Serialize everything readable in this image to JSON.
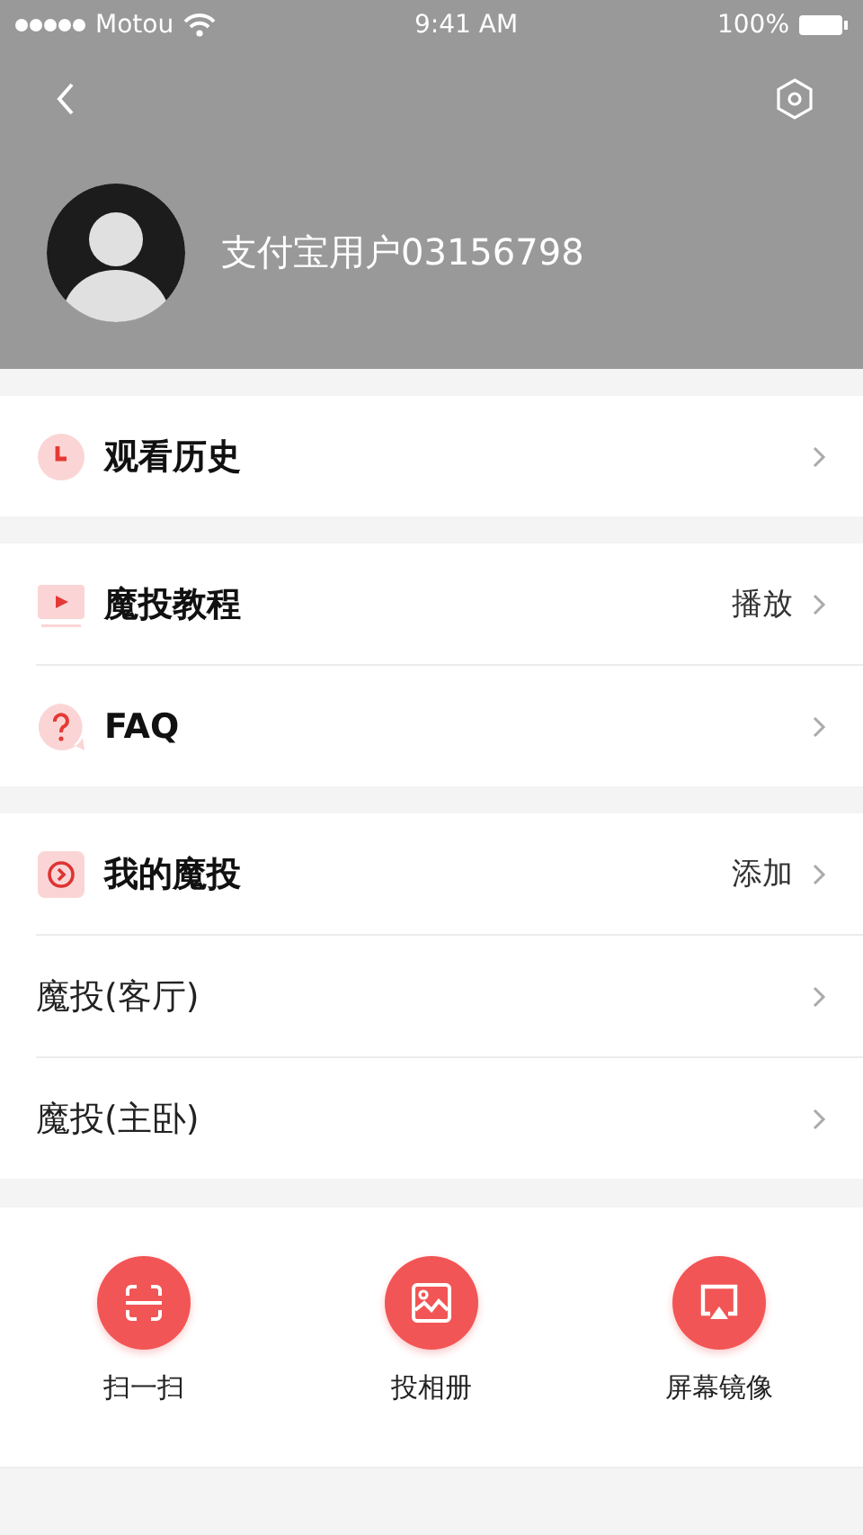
{
  "status_bar": {
    "carrier": "Motou",
    "time": "9:41 AM",
    "battery": "100%"
  },
  "profile": {
    "name": "支付宝用户03156798"
  },
  "sections": [
    {
      "rows": [
        {
          "kind": "icon",
          "label": "观看历史"
        }
      ]
    },
    {
      "rows": [
        {
          "kind": "icon",
          "label": "魔投教程",
          "detail": "播放"
        },
        {
          "kind": "icon",
          "label": "FAQ"
        }
      ]
    },
    {
      "rows": [
        {
          "kind": "icon",
          "label": "我的魔投",
          "detail": "添加"
        },
        {
          "kind": "plain",
          "label": "魔投(客厅)"
        },
        {
          "kind": "plain",
          "label": "魔投(主卧)"
        }
      ]
    }
  ],
  "actions": [
    {
      "label": "扫一扫"
    },
    {
      "label": "投相册"
    },
    {
      "label": "屏幕镜像"
    }
  ]
}
